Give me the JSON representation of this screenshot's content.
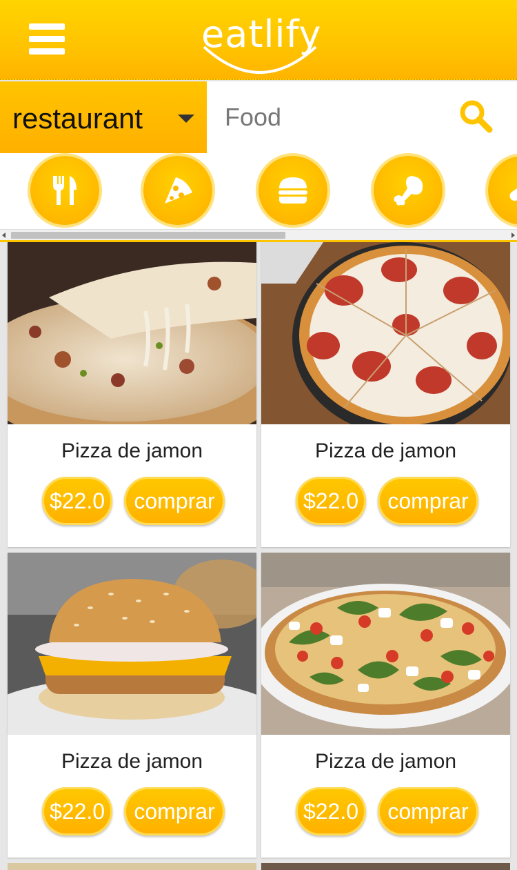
{
  "header": {
    "menu_icon": "hamburger-menu-icon",
    "logo_text": "eatlify",
    "brand_color": "#ffc300"
  },
  "search": {
    "type_label": "restaurant",
    "placeholder": "Food",
    "search_icon": "search-icon"
  },
  "categories": [
    {
      "icon": "fork-knife-icon"
    },
    {
      "icon": "pizza-slice-icon"
    },
    {
      "icon": "burger-icon"
    },
    {
      "icon": "chicken-leg-icon"
    },
    {
      "icon": "hotdog-icon"
    }
  ],
  "products": [
    {
      "name": "Pizza de jamon",
      "price": "$22.0",
      "buy_label": "comprar",
      "image": "ham-pizza-photo"
    },
    {
      "name": "Pizza de jamon",
      "price": "$22.0",
      "buy_label": "comprar",
      "image": "pepperoni-pizza-photo"
    },
    {
      "name": "Pizza de jamon",
      "price": "$22.0",
      "buy_label": "comprar",
      "image": "burger-photo"
    },
    {
      "name": "Pizza de jamon",
      "price": "$22.0",
      "buy_label": "comprar",
      "image": "arugula-tomato-pizza-photo"
    }
  ]
}
